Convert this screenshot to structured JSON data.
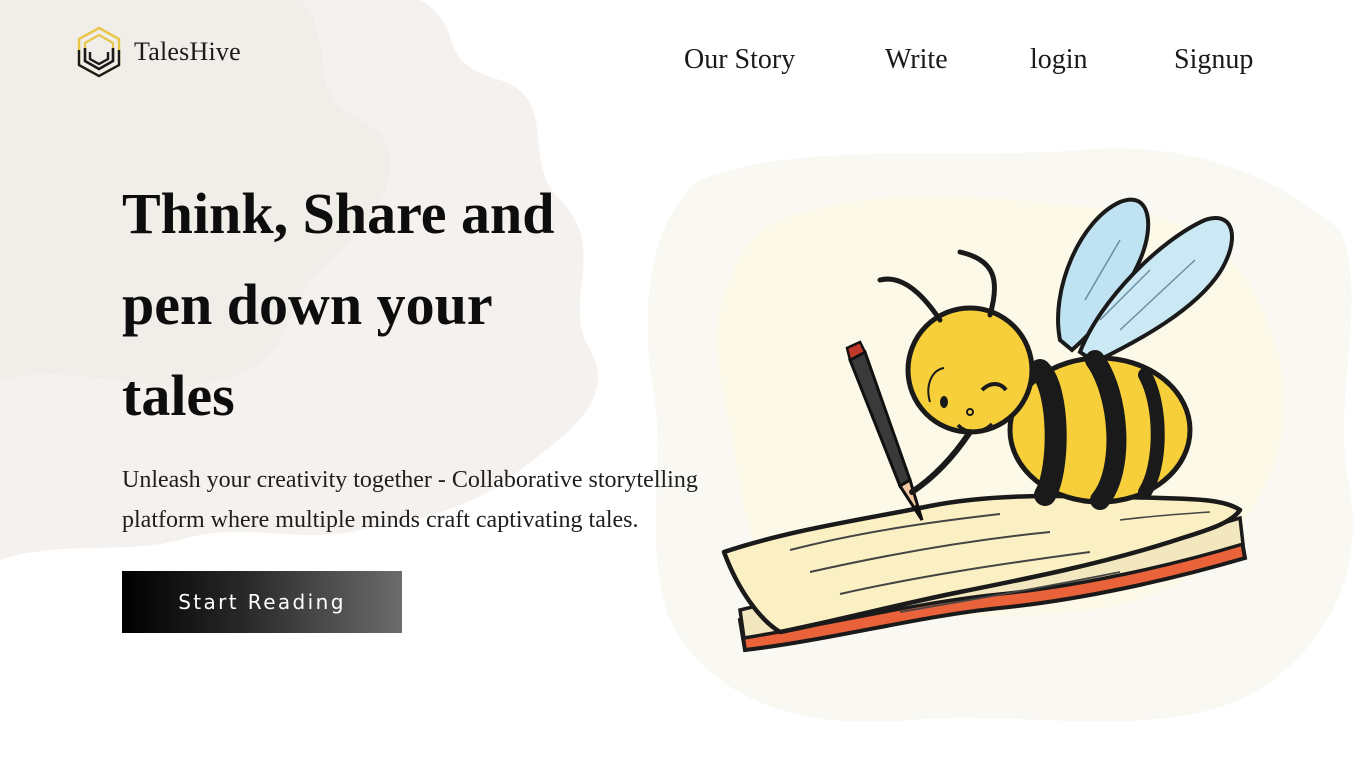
{
  "brand": {
    "name": "TalesHive",
    "logo_icon": "hexagon-stripes-logo-icon",
    "logo_colors": [
      "#e8c64a",
      "#1a1a1a"
    ]
  },
  "nav": {
    "items": [
      {
        "label": "Our Story"
      },
      {
        "label": "Write"
      },
      {
        "label": "login"
      },
      {
        "label": "Signup"
      }
    ]
  },
  "hero": {
    "title_lines": [
      "Think, Share and",
      "pen down your",
      "tales"
    ],
    "subtitle_lines": [
      "Unleash your creativity together - Collaborative storytelling",
      "platform where multiple minds craft captivating tales."
    ],
    "cta_label": "Start Reading",
    "illustration": "bee-writing-on-book-illustration"
  },
  "colors": {
    "text": "#111111",
    "cta_gradient_start": "#000000",
    "cta_gradient_end": "#6c6c6c",
    "bee_yellow": "#f6cf3a",
    "wing_blue": "#bfe3f2",
    "page_cream": "#fbf3c9"
  }
}
